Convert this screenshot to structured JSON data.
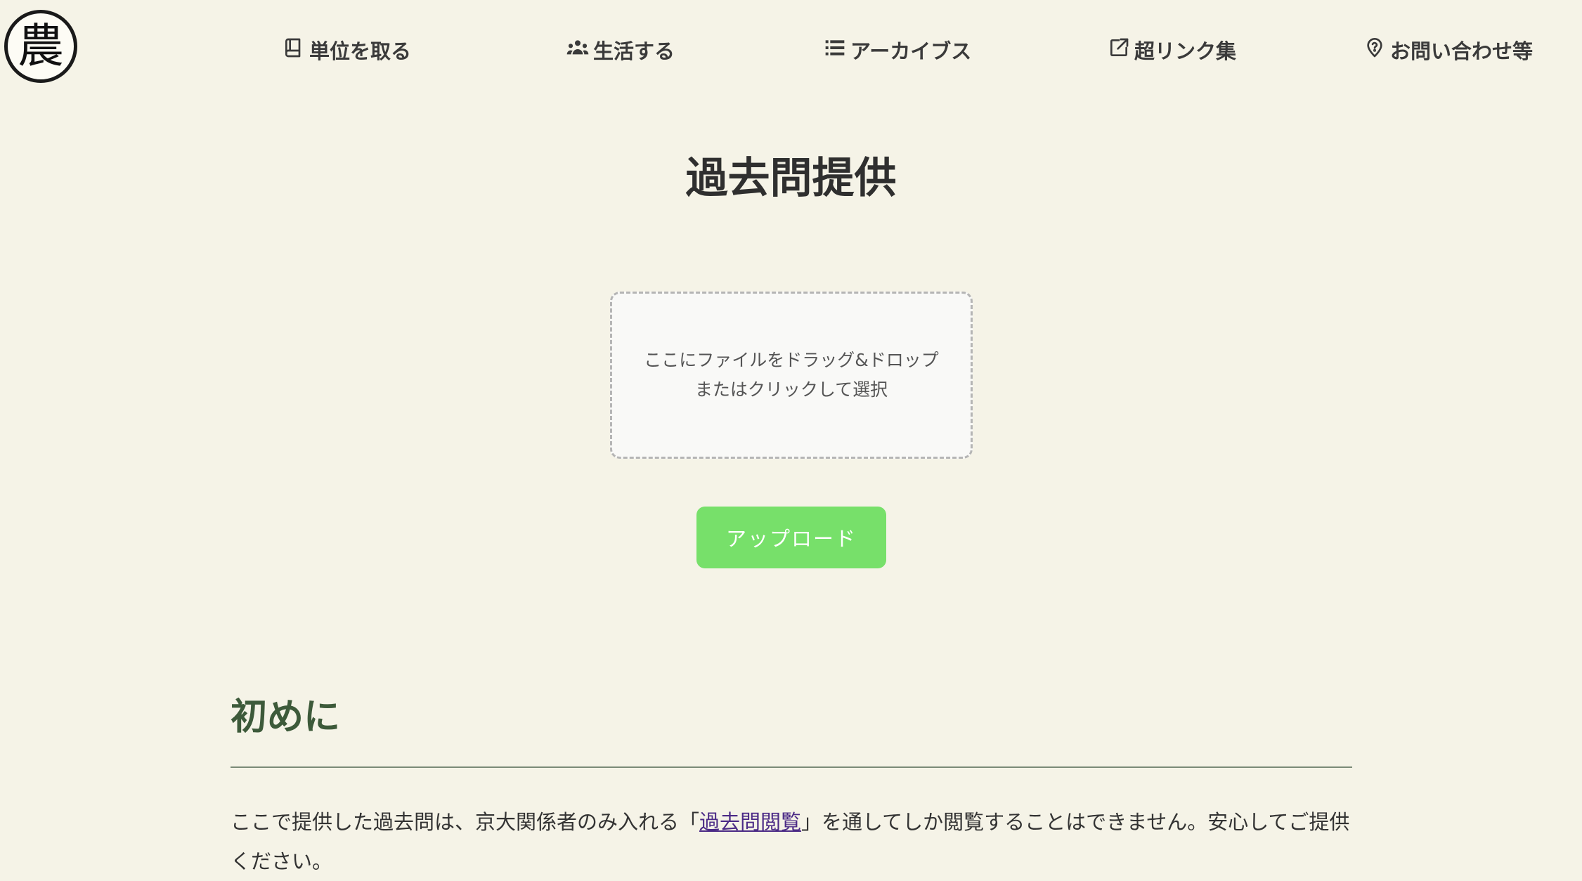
{
  "logo": {
    "glyph": "農"
  },
  "nav": {
    "items": [
      {
        "label": "単位を取る",
        "icon": "book-icon"
      },
      {
        "label": "生活する",
        "icon": "people-icon"
      },
      {
        "label": "アーカイブス",
        "icon": "list-icon"
      },
      {
        "label": "超リンク集",
        "icon": "external-link-icon"
      },
      {
        "label": "お問い合わせ等",
        "icon": "question-icon"
      }
    ]
  },
  "main": {
    "title": "過去問提供",
    "dropzone": {
      "line1": "ここにファイルをドラッグ&ドロップ",
      "line2": "またはクリックして選択"
    },
    "upload_label": "アップロード"
  },
  "intro": {
    "heading": "初めに",
    "text_before": "ここで提供した過去問は、京大関係者のみ入れる「",
    "link_text": "過去問閲覧",
    "text_after": "」を通してしか閲覧することはできません。安心してご提供ください。"
  },
  "colors": {
    "background": "#f5f3e7",
    "accent_button": "#77e06a",
    "heading_green": "#3d5a3a",
    "link": "#4b2a86"
  }
}
